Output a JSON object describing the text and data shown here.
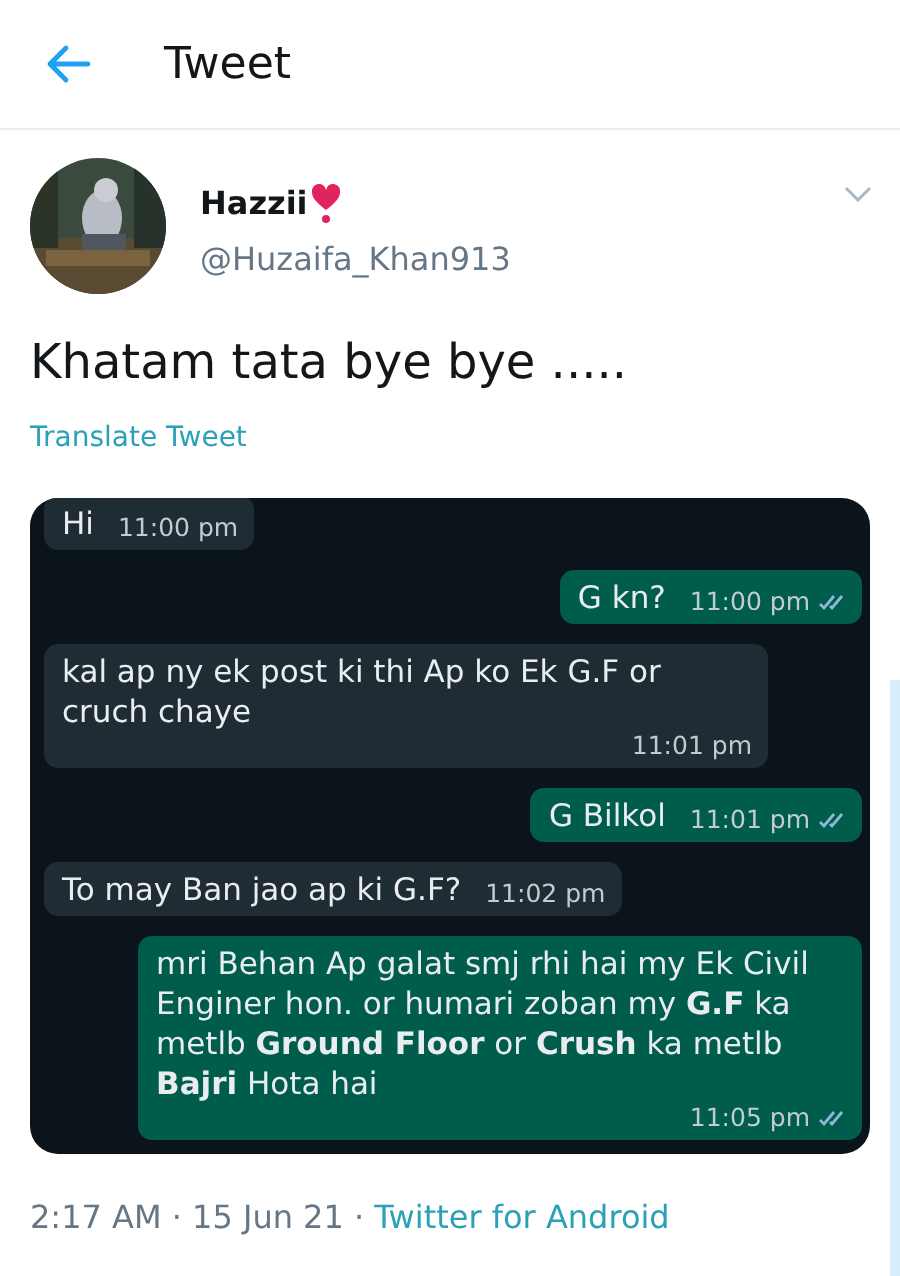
{
  "header": {
    "title": "Tweet"
  },
  "tweet": {
    "name": "Hazzii",
    "handle": "@Huzaifa_Khan913",
    "text": "Khatam tata bye bye .....",
    "translate": "Translate Tweet",
    "chat": [
      {
        "kind": "incoming",
        "text": "Hi",
        "time": "11:00 pm",
        "read": false
      },
      {
        "kind": "outgoing",
        "text": "G kn?",
        "time": "11:00 pm",
        "read": true
      },
      {
        "kind": "incoming",
        "text": "kal ap ny ek post ki thi Ap ko Ek G.F or cruch chaye",
        "time": "11:01 pm",
        "read": false
      },
      {
        "kind": "outgoing",
        "text": "G Bilkol",
        "time": "11:01 pm",
        "read": true
      },
      {
        "kind": "incoming",
        "text": "To may Ban jao ap ki G.F?",
        "time": "11:02 pm",
        "read": false
      },
      {
        "kind": "outgoing",
        "text": "mri Behan Ap galat smj rhi hai my Ek Civil Enginer hon. or humari zoban my **G.F** ka metlb **Ground Floor** or **Crush** ka metlb **Bajri** Hota hai",
        "time": "11:05 pm",
        "read": true
      }
    ],
    "time": "2:17 AM · 15 Jun 21 · ",
    "source": "Twitter for Android"
  }
}
